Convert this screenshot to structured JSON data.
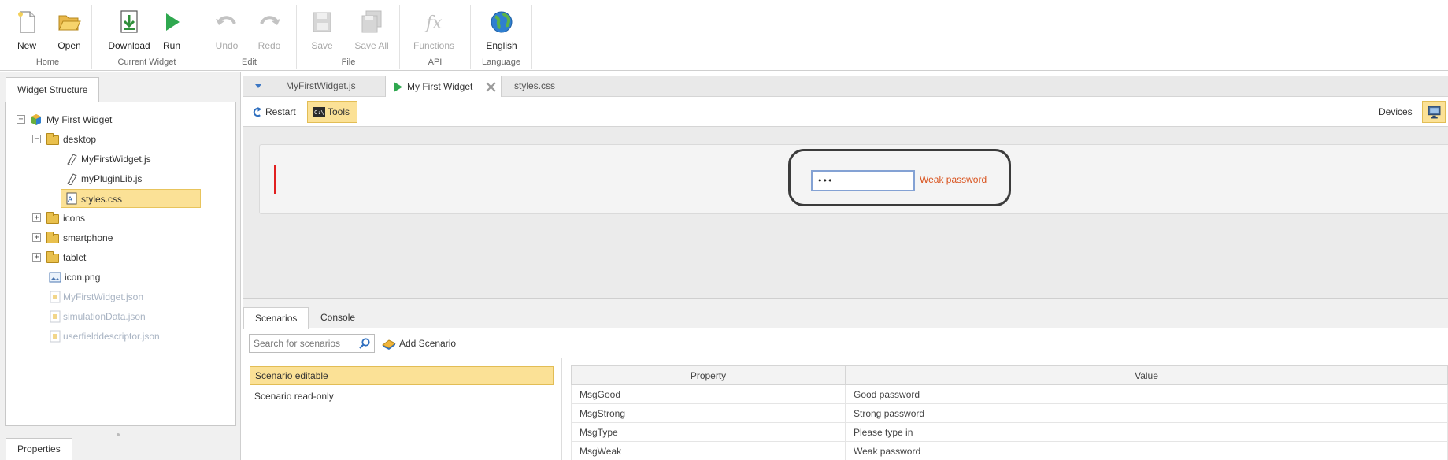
{
  "ribbon": {
    "groups": [
      {
        "label": "Home",
        "buttons": [
          {
            "label": "New",
            "icon": "new-file-icon"
          },
          {
            "label": "Open",
            "icon": "folder-open-icon"
          }
        ]
      },
      {
        "label": "Current Widget",
        "buttons": [
          {
            "label": "Download",
            "icon": "download-icon"
          },
          {
            "label": "Run",
            "icon": "run-icon"
          }
        ]
      },
      {
        "label": "Edit",
        "buttons": [
          {
            "label": "Undo",
            "icon": "undo-icon",
            "disabled": true
          },
          {
            "label": "Redo",
            "icon": "redo-icon",
            "disabled": true
          }
        ]
      },
      {
        "label": "File",
        "buttons": [
          {
            "label": "Save",
            "icon": "save-icon",
            "disabled": true
          },
          {
            "label": "Save All",
            "icon": "save-all-icon",
            "disabled": true
          }
        ]
      },
      {
        "label": "API",
        "buttons": [
          {
            "label": "Functions",
            "icon": "functions-icon",
            "disabled": true
          }
        ]
      },
      {
        "label": "Language",
        "buttons": [
          {
            "label": "English",
            "icon": "globe-icon"
          }
        ]
      }
    ]
  },
  "left_panel": {
    "tab": "Widget Structure",
    "bottom_tab": "Properties",
    "tree": [
      {
        "label": "My First Widget",
        "icon": "widget-icon",
        "expander": "−"
      },
      {
        "label": "desktop",
        "icon": "folder-open-icon",
        "expander": "−"
      },
      {
        "label": "MyFirstWidget.js",
        "icon": "js-file-icon"
      },
      {
        "label": "myPluginLib.js",
        "icon": "js-file-icon"
      },
      {
        "label": "styles.css",
        "icon": "css-file-icon",
        "selected": true
      },
      {
        "label": "icons",
        "icon": "folder-icon",
        "expander": "+"
      },
      {
        "label": "smartphone",
        "icon": "folder-icon",
        "expander": "+"
      },
      {
        "label": "tablet",
        "icon": "folder-icon",
        "expander": "+"
      },
      {
        "label": "icon.png",
        "icon": "image-file-icon"
      },
      {
        "label": "MyFirstWidget.json",
        "icon": "json-file-icon",
        "dim": true
      },
      {
        "label": "simulationData.json",
        "icon": "json-file-icon",
        "dim": true
      },
      {
        "label": "userfielddescriptor.json",
        "icon": "json-file-icon",
        "dim": true
      }
    ]
  },
  "editor": {
    "tabs": [
      {
        "label": "MyFirstWidget.js"
      },
      {
        "label": "My First Widget",
        "active": true
      },
      {
        "label": "styles.css"
      }
    ],
    "toolbar": {
      "restart": "Restart",
      "tools": "Tools",
      "devices": "Devices"
    }
  },
  "preview": {
    "password_value": "•••",
    "password_message": "Weak password",
    "message_color": "#d9531e"
  },
  "bottom": {
    "tabs": [
      {
        "label": "Scenarios",
        "active": true
      },
      {
        "label": "Console"
      }
    ],
    "search_placeholder": "Search for scenarios",
    "add_scenario": "Add Scenario",
    "scenarios": [
      {
        "label": "Scenario editable",
        "selected": true
      },
      {
        "label": "Scenario read-only"
      }
    ],
    "table": {
      "headers": [
        "Property",
        "Value"
      ],
      "rows": [
        [
          "MsgGood",
          "Good password"
        ],
        [
          "MsgStrong",
          "Strong password"
        ],
        [
          "MsgType",
          "Please type in"
        ],
        [
          "MsgWeak",
          "Weak password"
        ]
      ]
    }
  },
  "colors": {
    "accent": "#3b77c4",
    "selection": "#fbe196",
    "run_green": "#2fa84f"
  }
}
